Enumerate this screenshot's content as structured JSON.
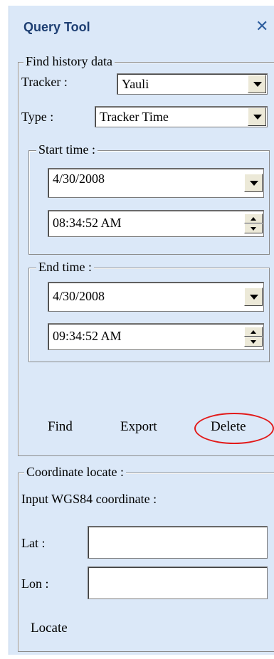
{
  "window": {
    "title": "Query Tool",
    "close_icon": "close-icon"
  },
  "history": {
    "group_label": "Find history data",
    "tracker_label": "Tracker :",
    "tracker_value": "Yauli",
    "type_label": "Type :",
    "type_value": "Tracker Time",
    "start": {
      "group_label": "Start time :",
      "date": "4/30/2008",
      "time": "08:34:52 AM"
    },
    "end": {
      "group_label": "End time :",
      "date": "4/30/2008",
      "time": "09:34:52 AM"
    },
    "buttons": {
      "find": "Find",
      "export": "Export",
      "delete": "Delete"
    }
  },
  "annotation": {
    "highlight_color": "#e21a1a"
  },
  "coordinate": {
    "group_label": "Coordinate locate :",
    "instruction": "Input WGS84 coordinate :",
    "lat_label": "Lat :",
    "lon_label": "Lon :",
    "lat_value": "",
    "lon_value": "",
    "locate_label": "Locate"
  }
}
